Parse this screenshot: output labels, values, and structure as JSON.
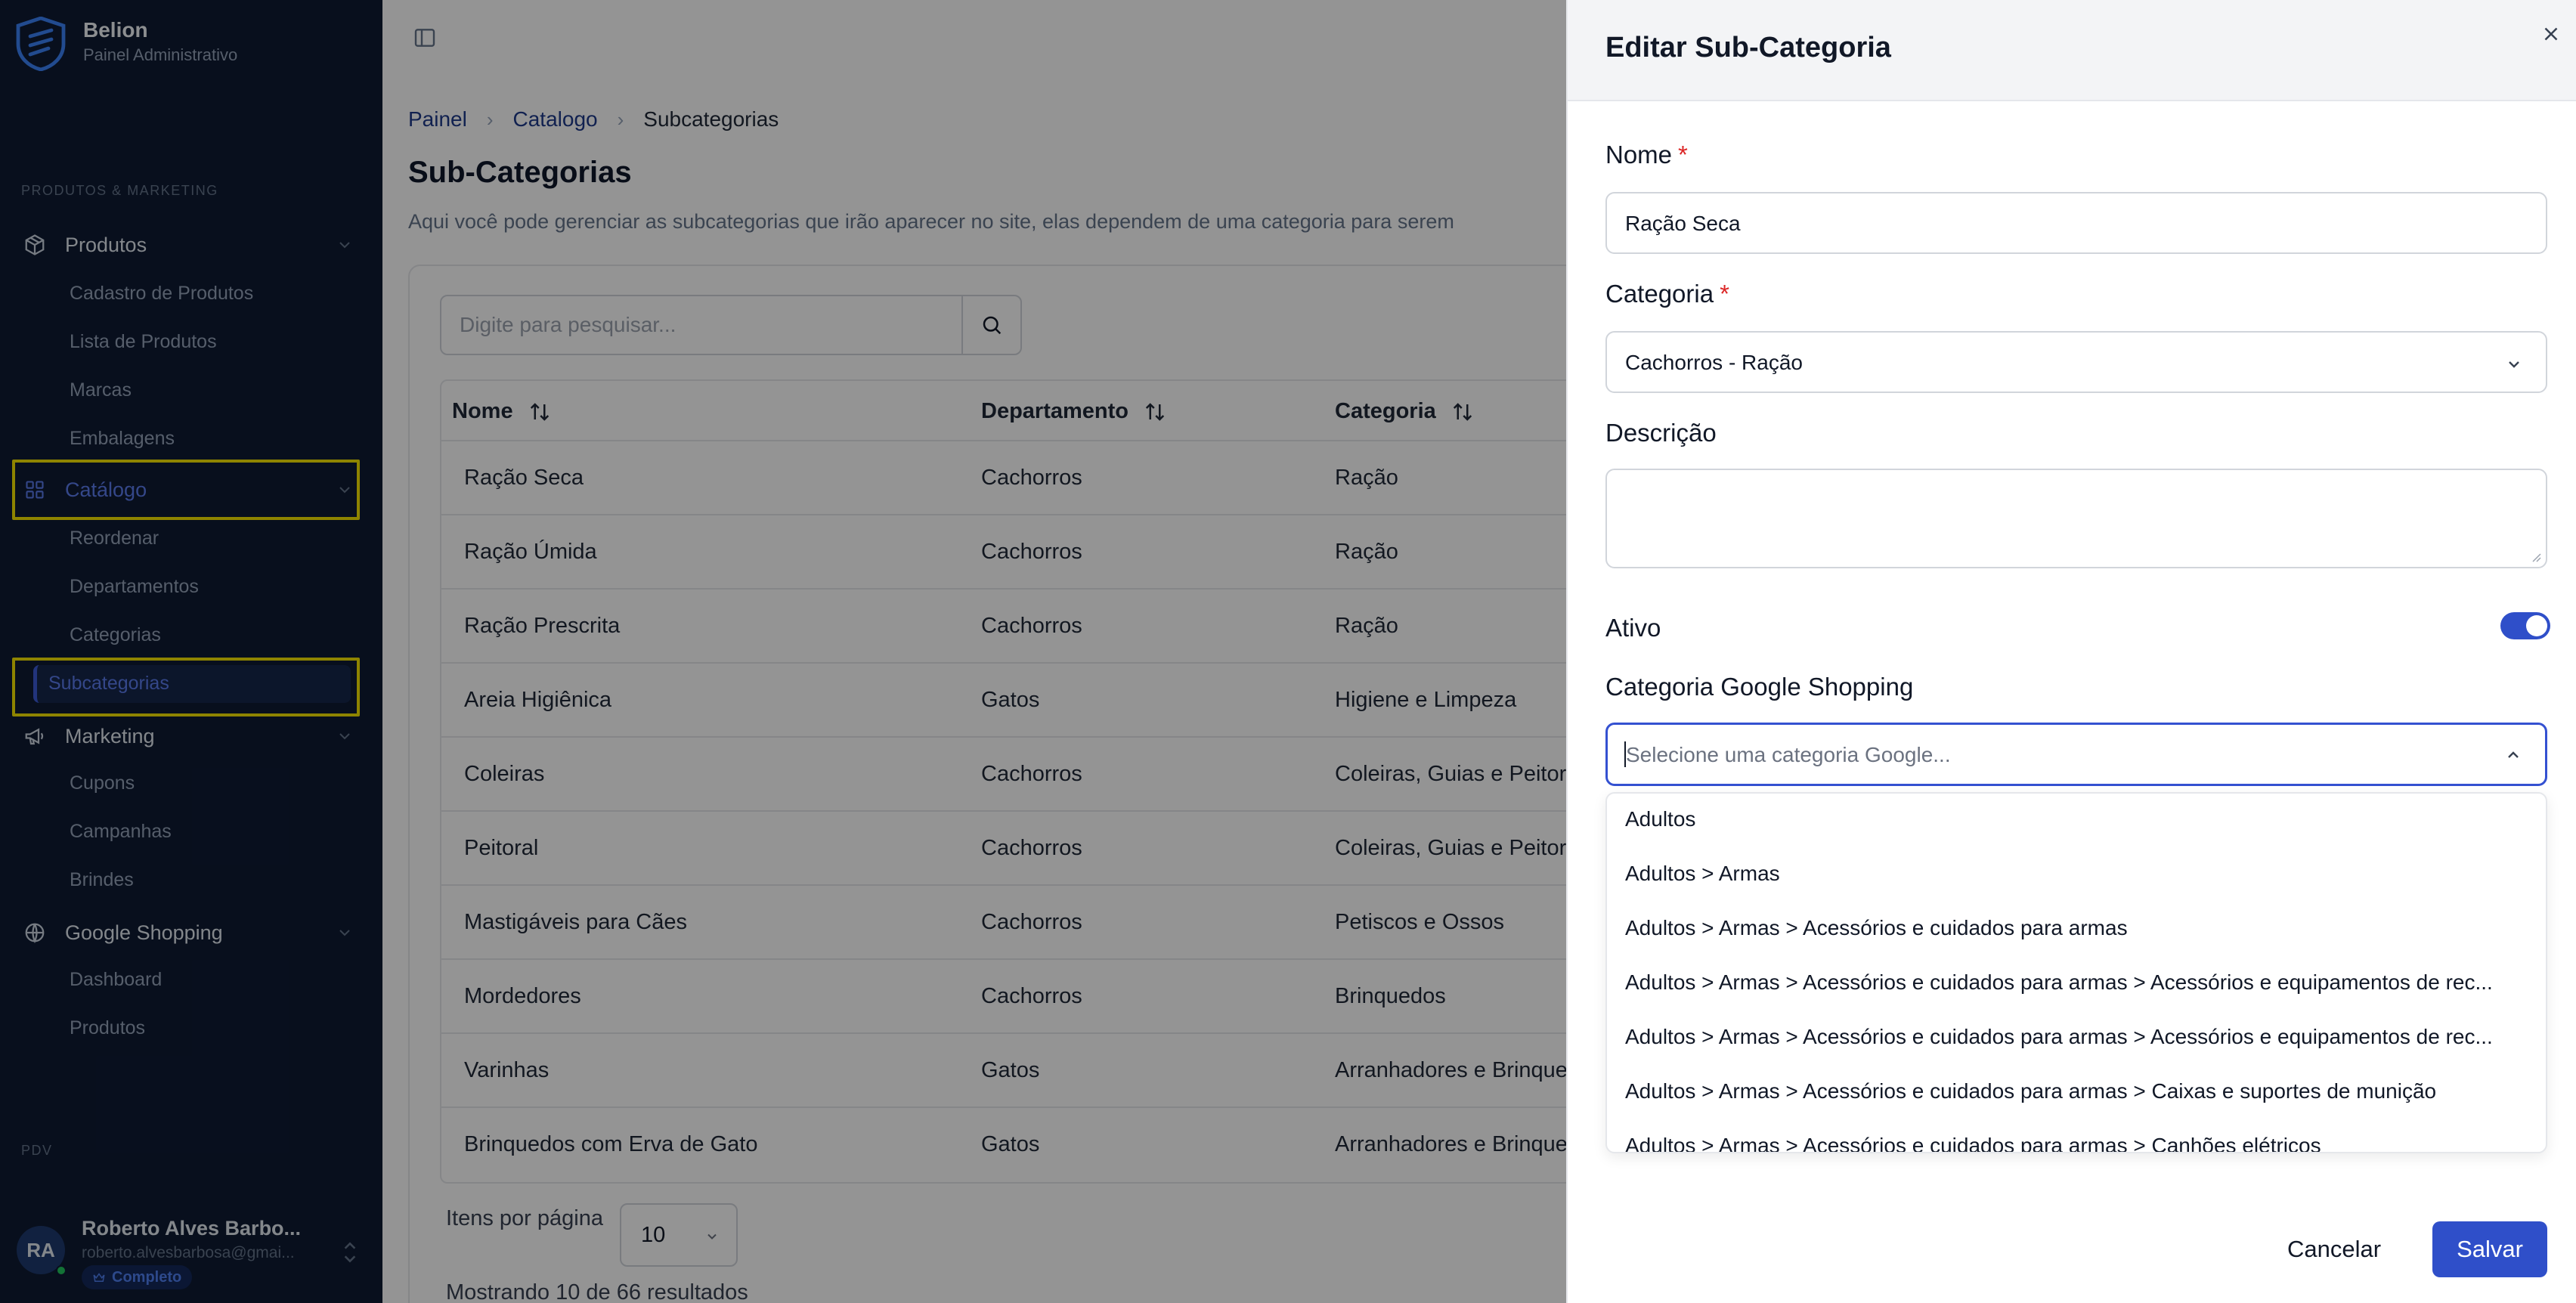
{
  "sidebar": {
    "brand": {
      "title": "Belion",
      "subtitle": "Painel Administrativo"
    },
    "section_label": "PRODUTOS & MARKETING",
    "groups": {
      "produtos": {
        "label": "Produtos",
        "items": [
          "Cadastro de Produtos",
          "Lista de Produtos",
          "Marcas",
          "Embalagens"
        ]
      },
      "catalogo": {
        "label": "Catálogo",
        "items": [
          "Reordenar",
          "Departamentos",
          "Categorias",
          "Subcategorias"
        ]
      },
      "marketing": {
        "label": "Marketing",
        "items": [
          "Cupons",
          "Campanhas",
          "Brindes"
        ]
      },
      "google": {
        "label": "Google Shopping",
        "items": [
          "Dashboard",
          "Produtos"
        ]
      }
    },
    "pdv_label": "PDV",
    "user": {
      "initials": "RA",
      "name": "Roberto Alves Barbo...",
      "email": "roberto.alvesbarbosa@gmai...",
      "badge": "Completo"
    }
  },
  "main": {
    "breadcrumb": [
      "Painel",
      "Catalogo",
      "Subcategorias"
    ],
    "title": "Sub-Categorias",
    "description": "Aqui você pode gerenciar as subcategorias que irão aparecer no site, elas dependem de uma categoria para serem",
    "search_placeholder": "Digite para pesquisar...",
    "columns": [
      "Nome",
      "Departamento",
      "Categoria"
    ],
    "rows": [
      [
        "Ração Seca",
        "Cachorros",
        "Ração"
      ],
      [
        "Ração Úmida",
        "Cachorros",
        "Ração"
      ],
      [
        "Ração Prescrita",
        "Cachorros",
        "Ração"
      ],
      [
        "Areia Higiênica",
        "Gatos",
        "Higiene e Limpeza"
      ],
      [
        "Coleiras",
        "Cachorros",
        "Coleiras, Guias e Peitor"
      ],
      [
        "Peitoral",
        "Cachorros",
        "Coleiras, Guias e Peitor"
      ],
      [
        "Mastigáveis para Cães",
        "Cachorros",
        "Petiscos e Ossos"
      ],
      [
        "Mordedores",
        "Cachorros",
        "Brinquedos"
      ],
      [
        "Varinhas",
        "Gatos",
        "Arranhadores e Brinque"
      ],
      [
        "Brinquedos com Erva de Gato",
        "Gatos",
        "Arranhadores e Brinque"
      ]
    ],
    "per_page_label": "Itens por página",
    "per_page_value": "10",
    "showing": "Mostrando 10 de 66 resultados"
  },
  "drawer": {
    "title": "Editar Sub-Categoria",
    "nome_label": "Nome",
    "nome_value": "Ração Seca",
    "categoria_label": "Categoria",
    "categoria_value": "Cachorros - Ração",
    "descricao_label": "Descrição",
    "ativo_label": "Ativo",
    "ativo_on": true,
    "google_label": "Categoria Google Shopping",
    "google_placeholder": "Selecione uma categoria Google...",
    "options": [
      "Adultos",
      "Adultos > Armas",
      "Adultos > Armas > Acessórios e cuidados para armas",
      "Adultos > Armas > Acessórios e cuidados para armas > Acessórios e equipamentos de rec...",
      "Adultos > Armas > Acessórios e cuidados para armas > Acessórios e equipamentos de rec...",
      "Adultos > Armas > Acessórios e cuidados para armas > Caixas e suportes de munição",
      "Adultos > Armas > Acessórios e cuidados para armas > Canhões elétricos"
    ],
    "cancel_label": "Cancelar",
    "save_label": "Salvar",
    "accent": "#2f4fc9"
  }
}
